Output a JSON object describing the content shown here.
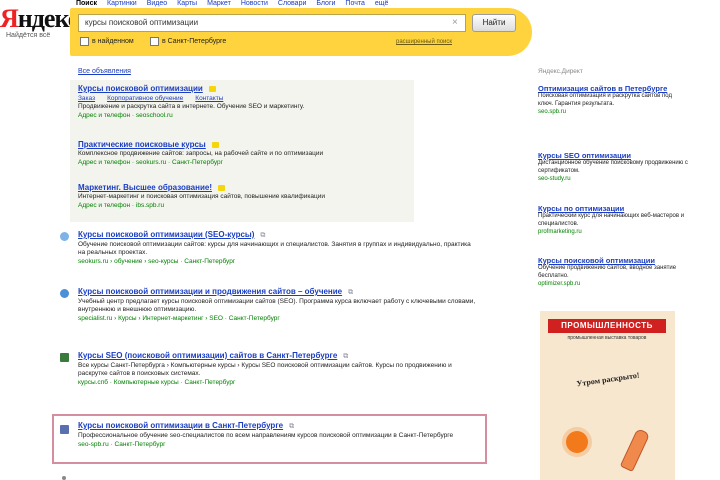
{
  "logo": {
    "word_y": "Я",
    "word_rest": "ндекс",
    "tagline": "Найдётся всё"
  },
  "services": [
    "Поиск",
    "Картинки",
    "Видео",
    "Карты",
    "Маркет",
    "Новости",
    "Словари",
    "Блоги",
    "Почта",
    "ещё"
  ],
  "search": {
    "query": "курсы поисковой оптимизации",
    "button": "Найти",
    "option1": "в найденном",
    "option2": "в Санкт-Петербурге",
    "advanced": "расширенный поиск"
  },
  "results": {
    "all_ads": "Все объявления",
    "items": [
      {
        "title": "Курсы поисковой оптимизации",
        "links": [
          "Заказ",
          "Корпоративное обучение",
          "Контакты"
        ],
        "text": "Продвижение и раскрутка сайта в интернете. Обучение SEO и маркетингу.",
        "url": "Адрес и телефон · seoschool.ru"
      },
      {
        "title": "Практические поисковые курсы",
        "text": "Комплексное продвижение сайтов: запросы, на рабочей сайте и по оптимизации",
        "url": "Адрес и телефон · seokurs.ru · Санкт-Петербург"
      },
      {
        "title": "Маркетинг. Высшее образование!",
        "text": "Интернет-маркетинг и поисковая оптимизация сайтов, повышение квалификации",
        "url": "Адрес и телефон · ibs.spb.ru"
      },
      {
        "title": "Курсы поисковой оптимизации (SEO-курсы)",
        "text": "Обучение поисковой оптимизации сайтов: курсы для начинающих и специалистов. Занятия в группах и индивидуально, практика на реальных проектах.",
        "url": "seokurs.ru › обучение › seo-курсы · Санкт-Петербург"
      },
      {
        "title": "Курсы поисковой оптимизации и продвижения сайтов – обучение",
        "text": "Учебный центр предлагает курсы поисковой оптимизации сайтов (SEO). Программа курса включает работу с ключевыми словами, внутреннюю и внешнюю оптимизацию.",
        "url": "specialist.ru › Курсы › Интернет-маркетинг › SEO · Санкт-Петербург"
      },
      {
        "title": "Курсы SEO (поисковой оптимизации) сайтов в Санкт-Петербурге",
        "text": "Все курсы Санкт-Петербурга › Компьютерные курсы › Курсы SEO поисковой оптимизации сайтов. Курсы по продвижению и раскрутке сайтов в поисковых системах.",
        "url": "курсы.спб · Компьютерные курсы · Санкт-Петербург"
      },
      {
        "title": "Курсы поисковой оптимизации в Санкт-Петербурге",
        "text": "Профессиональное обучение seo-специалистов по всем направлениям курсов поисковой оптимизации в Санкт-Петербурге",
        "url": "seo-spb.ru · Санкт-Петербург"
      }
    ]
  },
  "right_column": {
    "title": "Яндекс.Директ",
    "ads": [
      {
        "title": "Оптимизация сайтов в Петербурге",
        "text": "Поисковая оптимизация и раскрутка сайтов под ключ. Гарантия результата.",
        "url": "seo.spb.ru"
      },
      {
        "title": "Курсы SEO оптимизации",
        "text": "Дистанционное обучение поисковому продвижению с сертификатом.",
        "url": "seo-study.ru"
      },
      {
        "title": "Курсы по оптимизации",
        "text": "Практический курс для начинающих веб-мастеров и специалистов.",
        "url": "profmarketing.ru"
      },
      {
        "title": "Курсы поисковой оптимизации",
        "text": "Обучение продвижению сайтов, вводное занятие бесплатно.",
        "url": "optimizer.spb.ru"
      }
    ]
  },
  "banner": {
    "head": "ПРОМЫШЛЕННОСТЬ",
    "sub": "промышленная выставка товаров",
    "slogan": "Утром раскрыто!"
  },
  "colors": {
    "link": "#1a3dc1",
    "url": "#008000",
    "search_bar": "#ffd33d",
    "highlight_border": "#d58ea0"
  }
}
